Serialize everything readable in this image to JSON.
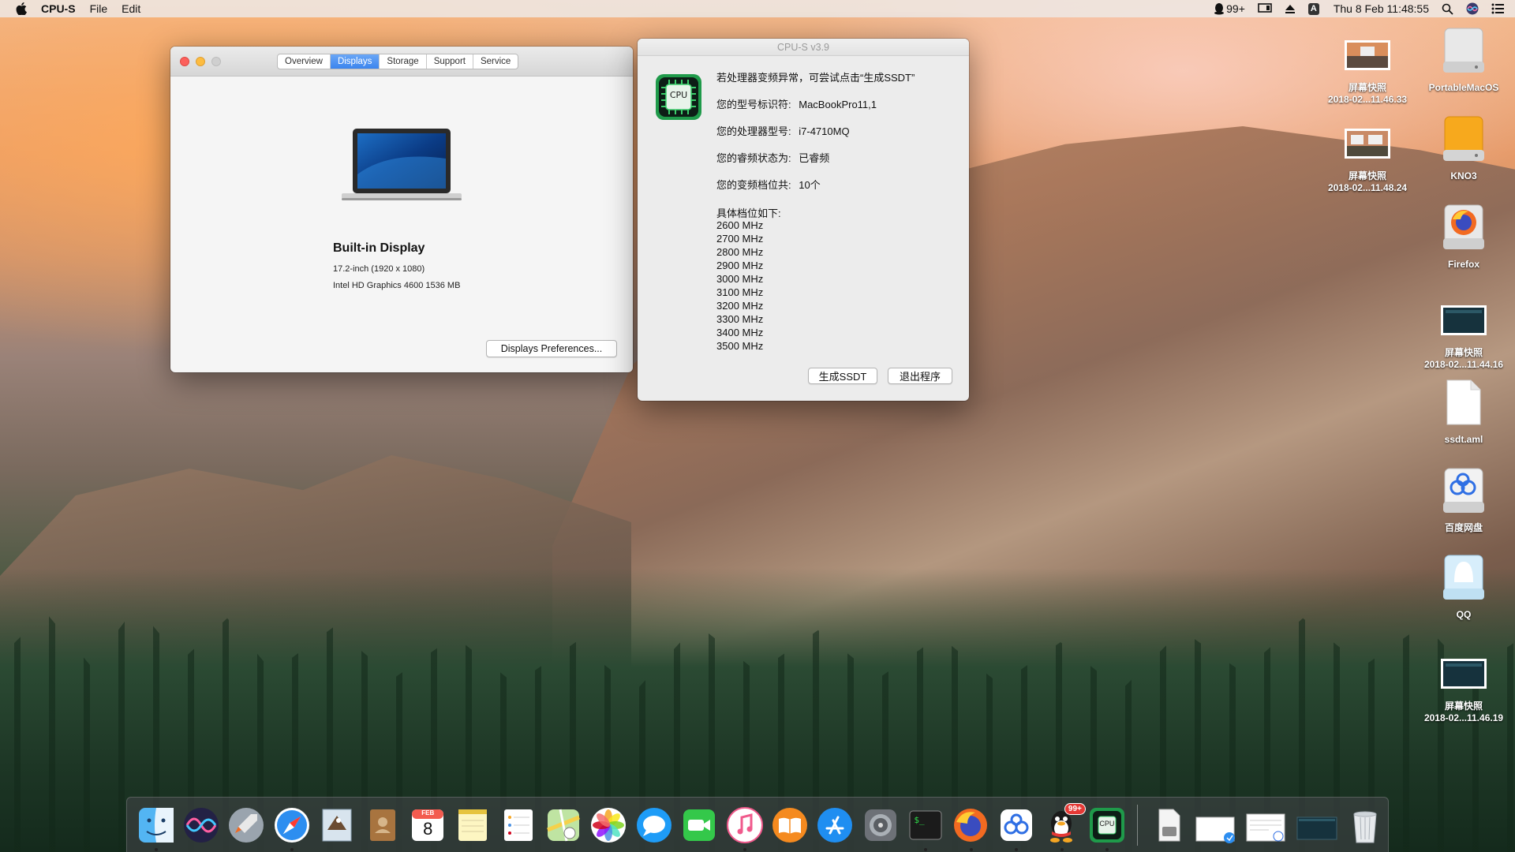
{
  "menubar": {
    "app_name": "CPU-S",
    "menus": [
      "File",
      "Edit"
    ],
    "qq_count": "99+",
    "input_method": "A",
    "clock": "Thu 8 Feb  11:48:55"
  },
  "about_window": {
    "tabs": [
      "Overview",
      "Displays",
      "Storage",
      "Support",
      "Service"
    ],
    "active_tab": "Displays",
    "display_title": "Built-in Display",
    "display_size": "17.2-inch (1920 x 1080)",
    "display_graphics": "Intel HD Graphics 4600 1536 MB",
    "pref_button": "Displays Preferences..."
  },
  "cpus_window": {
    "title": "CPU-S v3.9",
    "logo_text": "CPU",
    "rows": [
      {
        "label": "若处理器变频异常，可尝试点击“生成SSDT”"
      },
      {
        "label": "您的型号标识符:",
        "value": "MacBookPro11,1"
      },
      {
        "label": "您的处理器型号:",
        "value": "i7-4710MQ"
      },
      {
        "label": "您的睿频状态为:",
        "value": "已睿频"
      },
      {
        "label": "您的变频档位共:",
        "value": "10个"
      }
    ],
    "freq_heading": "具体档位如下:",
    "freqs": [
      "2600 MHz",
      "2700 MHz",
      "2800 MHz",
      "2900 MHz",
      "3000 MHz",
      "3100 MHz",
      "3200 MHz",
      "3300 MHz",
      "3400 MHz",
      "3500 MHz"
    ],
    "gen_button": "生成SSDT",
    "quit_button": "退出程序"
  },
  "desktop_icons": [
    {
      "name": "screenshot-1",
      "line1": "屏幕快照",
      "line2": "2018-02...11.46.33"
    },
    {
      "name": "portablemacos",
      "line1": "PortableMacOS",
      "line2": ""
    },
    {
      "name": "screenshot-2",
      "line1": "屏幕快照",
      "line2": "2018-02...11.48.24"
    },
    {
      "name": "kno3",
      "line1": "KNO3",
      "line2": ""
    },
    {
      "name": "firefox",
      "line1": "Firefox",
      "line2": ""
    },
    {
      "name": "screenshot-3",
      "line1": "屏幕快照",
      "line2": "2018-02...11.44.16"
    },
    {
      "name": "ssdt",
      "line1": "ssdt.aml",
      "line2": ""
    },
    {
      "name": "baidu",
      "line1": "百度网盘",
      "line2": ""
    },
    {
      "name": "qq",
      "line1": "QQ",
      "line2": ""
    },
    {
      "name": "screenshot-4",
      "line1": "屏幕快照",
      "line2": "2018-02...11.46.19"
    }
  ],
  "dock": {
    "calendar_month": "FEB",
    "calendar_day": "8",
    "qq_badge": "99+",
    "cpu_text": "CPU",
    "terminal_prompt": "$_"
  }
}
